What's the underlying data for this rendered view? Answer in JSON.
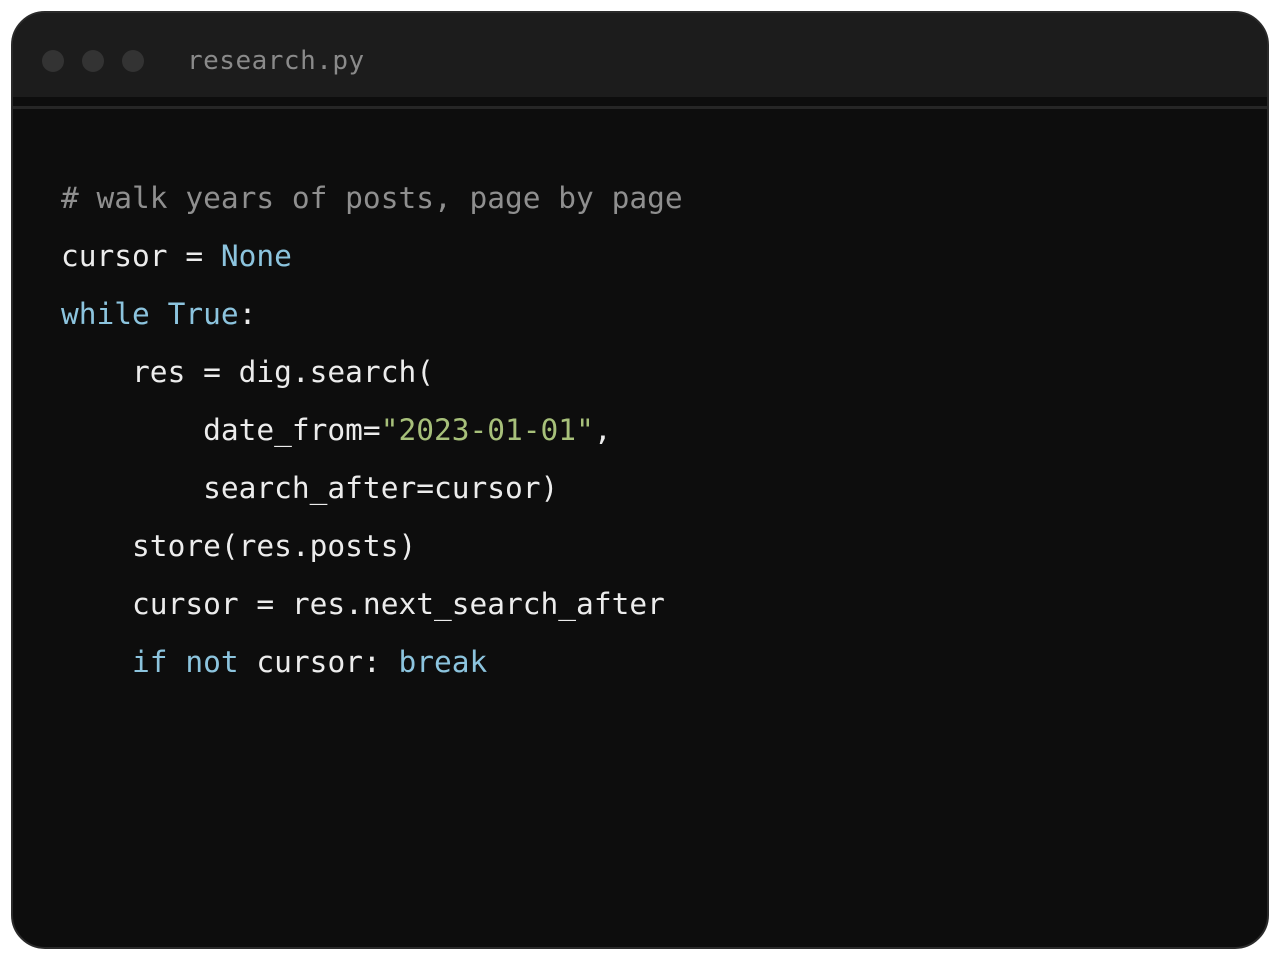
{
  "window": {
    "filename": "research.py"
  },
  "code": {
    "lines": [
      [
        {
          "t": "# walk years of posts, page by page",
          "k": "comment"
        }
      ],
      [
        {
          "t": "cursor = ",
          "k": "plain"
        },
        {
          "t": "None",
          "k": "kw"
        }
      ],
      [
        {
          "t": "while",
          "k": "kw"
        },
        {
          "t": " ",
          "k": "plain"
        },
        {
          "t": "True",
          "k": "kw"
        },
        {
          "t": ":",
          "k": "plain"
        }
      ],
      [
        {
          "t": "    res = dig.search(",
          "k": "plain"
        }
      ],
      [
        {
          "t": "        date_from=",
          "k": "plain"
        },
        {
          "t": "\"2023-01-01\"",
          "k": "str"
        },
        {
          "t": ",",
          "k": "plain"
        }
      ],
      [
        {
          "t": "        search_after=cursor)",
          "k": "plain"
        }
      ],
      [
        {
          "t": "    store(res.posts)",
          "k": "plain"
        }
      ],
      [
        {
          "t": "    cursor = res.next_search_after",
          "k": "plain"
        }
      ],
      [
        {
          "t": "    ",
          "k": "plain"
        },
        {
          "t": "if",
          "k": "kw"
        },
        {
          "t": " ",
          "k": "plain"
        },
        {
          "t": "not",
          "k": "kw"
        },
        {
          "t": " cursor: ",
          "k": "plain"
        },
        {
          "t": "break",
          "k": "kw"
        }
      ]
    ]
  },
  "colors": {
    "window_bg": "#0d0d0d",
    "titlebar_bg": "#1c1c1c",
    "keyword": "#8cc4de",
    "string": "#a7c07a",
    "comment": "#8f8f8f",
    "text": "#ececec"
  }
}
